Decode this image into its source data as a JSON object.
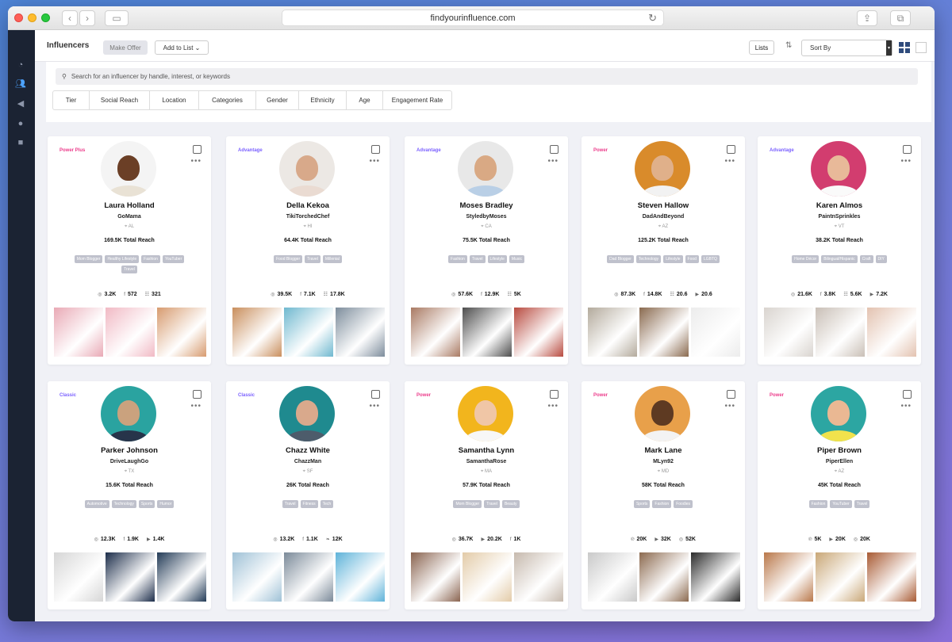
{
  "browser": {
    "url": "findyourinfluence.com"
  },
  "toolbar": {
    "title": "Influencers",
    "make_offer": "Make Offer",
    "add_to_list": "Add to List",
    "lists": "Lists",
    "sort_by": "Sort By"
  },
  "search": {
    "placeholder": "Search for an influencer by handle, interest, or keywords"
  },
  "filters": [
    "Tier",
    "Social Reach",
    "Location",
    "Categories",
    "Gender",
    "Ethnicity",
    "Age",
    "Engagement Rate"
  ],
  "colors": {
    "sidebar": "#1b2333",
    "tier_purple": "#7b61ff",
    "tier_pink": "#ec3c8b",
    "tag_gray": "#bfc1cc"
  },
  "cards": [
    {
      "tier": "Power Plus",
      "tier_color": "#ec3c8b",
      "name": "Laura Holland",
      "handle": "GoMama",
      "location": "AL",
      "reach": "169.5K Total Reach",
      "tags": [
        "Mom Blogger",
        "Healthy Lifestyle",
        "Fashion",
        "YouTuber",
        "Travel"
      ],
      "stats": [
        {
          "icon": "instagram-icon",
          "v": "3.2K"
        },
        {
          "icon": "facebook-icon",
          "v": "572"
        },
        {
          "icon": "blog-icon",
          "v": "321"
        }
      ],
      "avatar_bg": "#f4f4f4",
      "skin": "#6b3f26",
      "cloth": "#e9e2d5",
      "thumbs": [
        "#e9a9b5",
        "#f1b9c4",
        "#d79b6f"
      ]
    },
    {
      "tier": "Advantage",
      "tier_color": "#7b61ff",
      "name": "Della Kekoa",
      "handle": "TikiTorchedChef",
      "location": "HI",
      "reach": "64.4K Total Reach",
      "tags": [
        "Food Blogger",
        "Travel",
        "Millenial"
      ],
      "stats": [
        {
          "icon": "instagram-icon",
          "v": "39.5K"
        },
        {
          "icon": "facebook-icon",
          "v": "7.1K"
        },
        {
          "icon": "blog-icon",
          "v": "17.8K"
        }
      ],
      "avatar_bg": "#ece8e4",
      "skin": "#d8a98a",
      "cloth": "#eadbd2",
      "thumbs": [
        "#c98f5d",
        "#6fb8cf",
        "#7d8d9c"
      ]
    },
    {
      "tier": "Advantage",
      "tier_color": "#7b61ff",
      "name": "Moses Bradley",
      "handle": "StyledbyMoses",
      "location": "CA",
      "reach": "75.5K Total Reach",
      "tags": [
        "Fashion",
        "Travel",
        "Lifestyle",
        "Music"
      ],
      "stats": [
        {
          "icon": "instagram-icon",
          "v": "57.6K"
        },
        {
          "icon": "facebook-icon",
          "v": "12.9K"
        },
        {
          "icon": "blog-icon",
          "v": "5K"
        }
      ],
      "avatar_bg": "#e8e8e8",
      "skin": "#d9a984",
      "cloth": "#b9cfe6",
      "thumbs": [
        "#a97a63",
        "#4d4d4d",
        "#b84b40"
      ]
    },
    {
      "tier": "Power",
      "tier_color": "#ec3c8b",
      "name": "Steven Hallow",
      "handle": "DadAndBeyond",
      "location": "AZ",
      "reach": "125.2K Total Reach",
      "tags": [
        "Dad Blogger",
        "Technology",
        "Lifestyle",
        "Food",
        "LGBTQ"
      ],
      "stats": [
        {
          "icon": "instagram-icon",
          "v": "87.3K"
        },
        {
          "icon": "facebook-icon",
          "v": "14.8K"
        },
        {
          "icon": "blog-icon",
          "v": "20.6"
        },
        {
          "icon": "youtube-icon",
          "v": "20.6"
        }
      ],
      "avatar_bg": "#d98b2b",
      "skin": "#e0b08a",
      "cloth": "#f2f2f2",
      "thumbs": [
        "#b3aa9c",
        "#8a6a4f",
        "#ececec"
      ]
    },
    {
      "tier": "Advantage",
      "tier_color": "#7b61ff",
      "name": "Karen Almos",
      "handle": "PaintnSprinkles",
      "location": "VT",
      "reach": "38.2K Total Reach",
      "tags": [
        "Home Décor",
        "Bilingual/Hispanic",
        "Craft",
        "DIY"
      ],
      "stats": [
        {
          "icon": "instagram-icon",
          "v": "21.6K"
        },
        {
          "icon": "facebook-icon",
          "v": "3.8K"
        },
        {
          "icon": "blog-icon",
          "v": "5.6K"
        },
        {
          "icon": "youtube-icon",
          "v": "7.2K"
        }
      ],
      "avatar_bg": "#d23d6f",
      "skin": "#e8b999",
      "cloth": "#fafafa",
      "thumbs": [
        "#d9d4cf",
        "#c9bfb6",
        "#e3c2b0"
      ]
    },
    {
      "tier": "Classic",
      "tier_color": "#7b61ff",
      "name": "Parker Johnson",
      "handle": "DriveLaughGo",
      "location": "TX",
      "reach": "15.6K Total Reach",
      "tags": [
        "Automotive",
        "Technology",
        "Sports",
        "Humor"
      ],
      "stats": [
        {
          "icon": "instagram-icon",
          "v": "12.3K"
        },
        {
          "icon": "facebook-icon",
          "v": "1.9K"
        },
        {
          "icon": "youtube-icon",
          "v": "1.4K"
        }
      ],
      "avatar_bg": "#2aa3a0",
      "skin": "#caa27e",
      "cloth": "#27344a",
      "thumbs": [
        "#d6d6d6",
        "#1c2d4a",
        "#233b57"
      ]
    },
    {
      "tier": "Classic",
      "tier_color": "#7b61ff",
      "name": "Chazz White",
      "handle": "ChazzMan",
      "location": "SF",
      "reach": "26K Total Reach",
      "tags": [
        "Travel",
        "Fitness",
        "Tech"
      ],
      "stats": [
        {
          "icon": "instagram-icon",
          "v": "13.2K"
        },
        {
          "icon": "facebook-icon",
          "v": "1.1K"
        },
        {
          "icon": "twitter-icon",
          "v": "12K"
        }
      ],
      "avatar_bg": "#1f8a8f",
      "skin": "#d9a98c",
      "cloth": "#4d5c6b",
      "thumbs": [
        "#9fc1d6",
        "#7b8a99",
        "#5fb3d9"
      ]
    },
    {
      "tier": "Power",
      "tier_color": "#ec3c8b",
      "name": "Samantha Lynn",
      "handle": "SamanthaRose",
      "location": "MA",
      "reach": "57.9K Total Reach",
      "tags": [
        "Mom Blogger",
        "Travel",
        "Beauty"
      ],
      "stats": [
        {
          "icon": "instagram-icon",
          "v": "36.7K"
        },
        {
          "icon": "youtube-icon",
          "v": "20.2K"
        },
        {
          "icon": "facebook-icon",
          "v": "1K"
        }
      ],
      "avatar_bg": "#f2b51d",
      "skin": "#f0c6a6",
      "cloth": "#f7f7f7",
      "thumbs": [
        "#8a6450",
        "#e3cba8",
        "#c6b9ad"
      ]
    },
    {
      "tier": "Power",
      "tier_color": "#ec3c8b",
      "name": "Mark Lane",
      "handle": "MLyn92",
      "location": "MD",
      "reach": "58K Total Reach",
      "tags": [
        "Sports",
        "Fashion",
        "Foodies"
      ],
      "stats": [
        {
          "icon": "pinterest-icon",
          "v": "20K"
        },
        {
          "icon": "youtube-icon",
          "v": "32K"
        },
        {
          "icon": "instagram-icon",
          "v": "52K"
        }
      ],
      "avatar_bg": "#e8a04a",
      "skin": "#5e3a22",
      "cloth": "#f3f3f3",
      "thumbs": [
        "#c9c9c9",
        "#8c6a4f",
        "#2b2b2b"
      ]
    },
    {
      "tier": "Power",
      "tier_color": "#ec3c8b",
      "name": "Piper Brown",
      "handle": "PiperEllen",
      "location": "AZ",
      "reach": "45K Total Reach",
      "tags": [
        "Fashion",
        "YouTuber",
        "Travel"
      ],
      "stats": [
        {
          "icon": "pinterest-icon",
          "v": "5K"
        },
        {
          "icon": "youtube-icon",
          "v": "20K"
        },
        {
          "icon": "instagram-icon",
          "v": "20K"
        }
      ],
      "avatar_bg": "#2ca6a2",
      "skin": "#eab893",
      "cloth": "#f1e24c",
      "thumbs": [
        "#b9784a",
        "#c9a777",
        "#a85a33"
      ]
    }
  ]
}
